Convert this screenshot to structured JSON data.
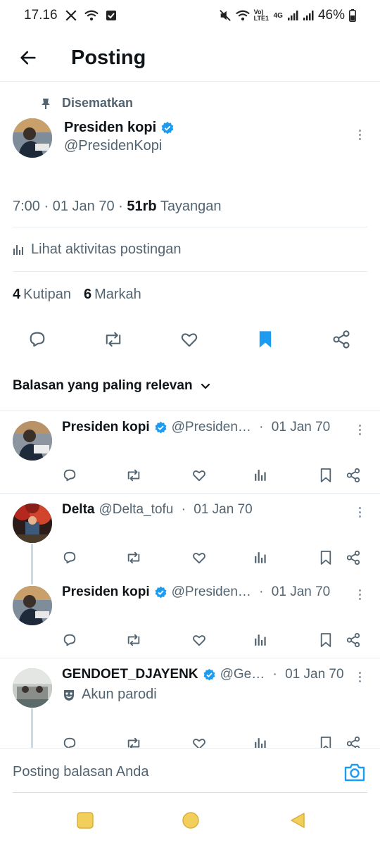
{
  "status_bar": {
    "time": "17.16",
    "battery": "46%",
    "network_label": "4G",
    "volte_label": "Vo) LTE1"
  },
  "header": {
    "title": "Posting"
  },
  "main_post": {
    "pinned_label": "Disematkan",
    "name": "Presiden kopi",
    "handle": "@PresidenKopi",
    "time": "7:00",
    "date": "01 Jan 70",
    "views_count": "51rb",
    "views_label": "Tayangan",
    "activity_label": "Lihat aktivitas postingan",
    "quotes_count": "4",
    "quotes_label": "Kutipan",
    "bookmarks_count": "6",
    "bookmarks_label": "Markah"
  },
  "sort_label": "Balasan yang paling relevan",
  "replies": [
    {
      "name": "Presiden kopi",
      "handle": "@Presiden…",
      "date": "01 Jan 70",
      "verified": true
    },
    {
      "name": "Delta",
      "handle": "@Delta_tofu",
      "date": "01 Jan 70",
      "verified": false
    },
    {
      "name": "Presiden kopi",
      "handle": "@Presiden…",
      "date": "01 Jan 70",
      "verified": true
    },
    {
      "name": "GENDOET_DJAYENK",
      "handle": "@Ge…",
      "date": "01 Jan 70",
      "verified": true,
      "badge": "Akun parodi"
    }
  ],
  "reply_bar": {
    "placeholder": "Posting balasan Anda"
  },
  "colors": {
    "accent": "#1d9bf0",
    "text_primary": "#0f1419",
    "text_secondary": "#536471",
    "nav_square": "#f2cf5b",
    "nav_circle": "#f2cf5b",
    "nav_back": "#f2cf5b"
  }
}
